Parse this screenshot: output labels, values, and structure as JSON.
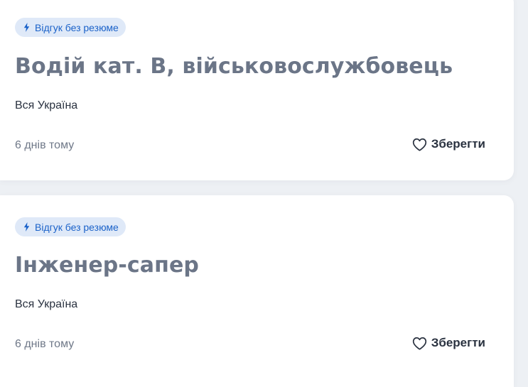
{
  "cards": [
    {
      "badge": "Відгук без резюме",
      "badge_icon": "lightning-icon",
      "title": "Водій кат. В, військовослужбовець",
      "location": "Вся Україна",
      "posted": "6 днів тому",
      "save_label": "Зберегти",
      "save_icon": "heart-icon"
    },
    {
      "badge": "Відгук без резюме",
      "badge_icon": "lightning-icon",
      "title": "Інженер-сапер",
      "location": "Вся Україна",
      "posted": "6 днів тому",
      "save_label": "Зберегти",
      "save_icon": "heart-icon"
    }
  ],
  "colors": {
    "page_background": "#edf0f4",
    "card_background": "#ffffff",
    "badge_background": "#dfe9f8",
    "badge_text": "#1b62c9",
    "title_text": "#6b7587",
    "body_text": "#2a3240",
    "muted_text": "#6f7888"
  }
}
